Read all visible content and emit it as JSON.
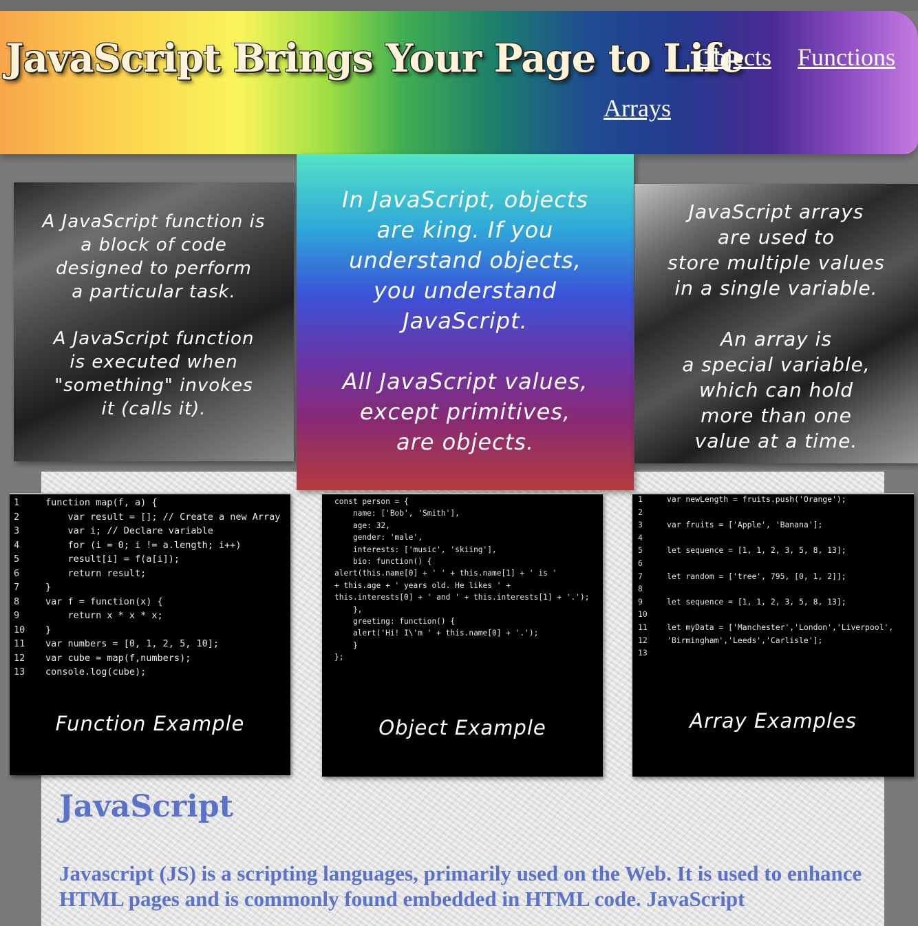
{
  "header": {
    "title": "JavaScript Brings Your Page to Life",
    "nav": [
      "Objects",
      "Functions",
      "Arrays"
    ]
  },
  "cards": {
    "functions": [
      "A JavaScript function is\na block of code\ndesigned to perform\na particular task.",
      "A JavaScript function\nis executed when\n\"something\" invokes\nit (calls it)."
    ],
    "objects": [
      "In JavaScript, objects\nare king. If you\nunderstand objects,\nyou understand\nJavaScript.",
      "All JavaScript values,\nexcept primitives,\nare objects."
    ],
    "arrays": [
      "JavaScript arrays\nare used to\nstore multiple values\nin a single variable.",
      "An array is\na special variable,\nwhich can hold\nmore than one\nvalue at a time."
    ]
  },
  "function_example": {
    "caption": "Function Example",
    "lines": [
      "function map(f, a) {",
      "    var result = []; // Create a new Array",
      "    var i; // Declare variable",
      "    for (i = 0; i != a.length; i++)",
      "    result[i] = f(a[i]);",
      "    return result;",
      "}",
      "var f = function(x) {",
      "    return x * x * x;",
      "}",
      "var numbers = [0, 1, 2, 5, 10];",
      "var cube = map(f,numbers);",
      "console.log(cube);"
    ]
  },
  "object_example": {
    "caption": "Object Example",
    "lines": [
      "const person = {",
      "    name: ['Bob', 'Smith'],",
      "    age: 32,",
      "    gender: 'male',",
      "    interests: ['music', 'skiing'],",
      "    bio: function() {",
      "alert(this.name[0] + ' ' + this.name[1] + ' is '",
      "+ this.age + ' years old. He likes ' +",
      "this.interests[0] + ' and ' + this.interests[1] + '.');",
      "    },",
      "    greeting: function() {",
      "    alert('Hi! I\\'m ' + this.name[0] + '.');",
      "    }",
      "};"
    ]
  },
  "array_example": {
    "caption": "Array Examples",
    "lines": [
      "var newLength = fruits.push('Orange');",
      "",
      "var fruits = ['Apple', 'Banana'];",
      "",
      "let sequence = [1, 1, 2, 3, 5, 8, 13];",
      "",
      "let random = ['tree', 795, [0, 1, 2]];",
      "",
      "let sequence = [1, 1, 2, 3, 5, 8, 13];",
      "",
      "let myData = ['Manchester','London','Liverpool',",
      "'Birmingham','Leeds','Carlisle'];",
      ""
    ]
  },
  "main": {
    "heading": "JavaScript",
    "body": "Javascript (JS) is a scripting languages, primarily used on the Web. It is used to enhance HTML pages and is commonly found embedded in HTML code. JavaScript"
  }
}
